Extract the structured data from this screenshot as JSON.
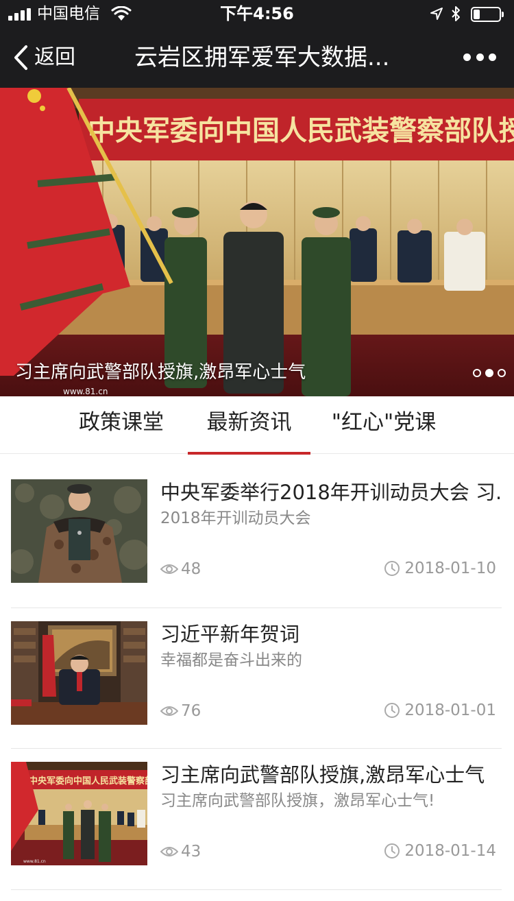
{
  "status_bar": {
    "carrier": "中国电信",
    "time": "下午4:56",
    "battery_level": 0.25
  },
  "nav": {
    "back_label": "返回",
    "title": "云岩区拥军爱军大数据..."
  },
  "banner": {
    "caption": "习主席向武警部队授旗,激昂军心士气",
    "banner_text": "中央军委向中国人民武装警察部队授旗",
    "slide_count": 3,
    "active_index": 1
  },
  "tabs": [
    {
      "label": "政策课堂",
      "active": false
    },
    {
      "label": "最新资讯",
      "active": true
    },
    {
      "label": "\"红心\"党课",
      "active": false
    }
  ],
  "articles": [
    {
      "title": "中央军委举行2018年开训动员大会 习.",
      "subtitle": "2018年开训动员大会",
      "views": "48",
      "date": "2018-01-10"
    },
    {
      "title": "习近平新年贺词",
      "subtitle": "幸福都是奋斗出来的",
      "views": "76",
      "date": "2018-01-01"
    },
    {
      "title": "习主席向武警部队授旗,激昂军心士气",
      "subtitle": "习主席向武警部队授旗，激昂军心士气!",
      "views": "43",
      "date": "2018-01-14"
    }
  ],
  "thumb3_text": "中央军委向中国人民武装警察部队授旗",
  "colors": {
    "bar_bg": "#1c1c1e",
    "accent_red": "#c8272a",
    "text_dark": "#222222",
    "text_muted": "#888888"
  }
}
